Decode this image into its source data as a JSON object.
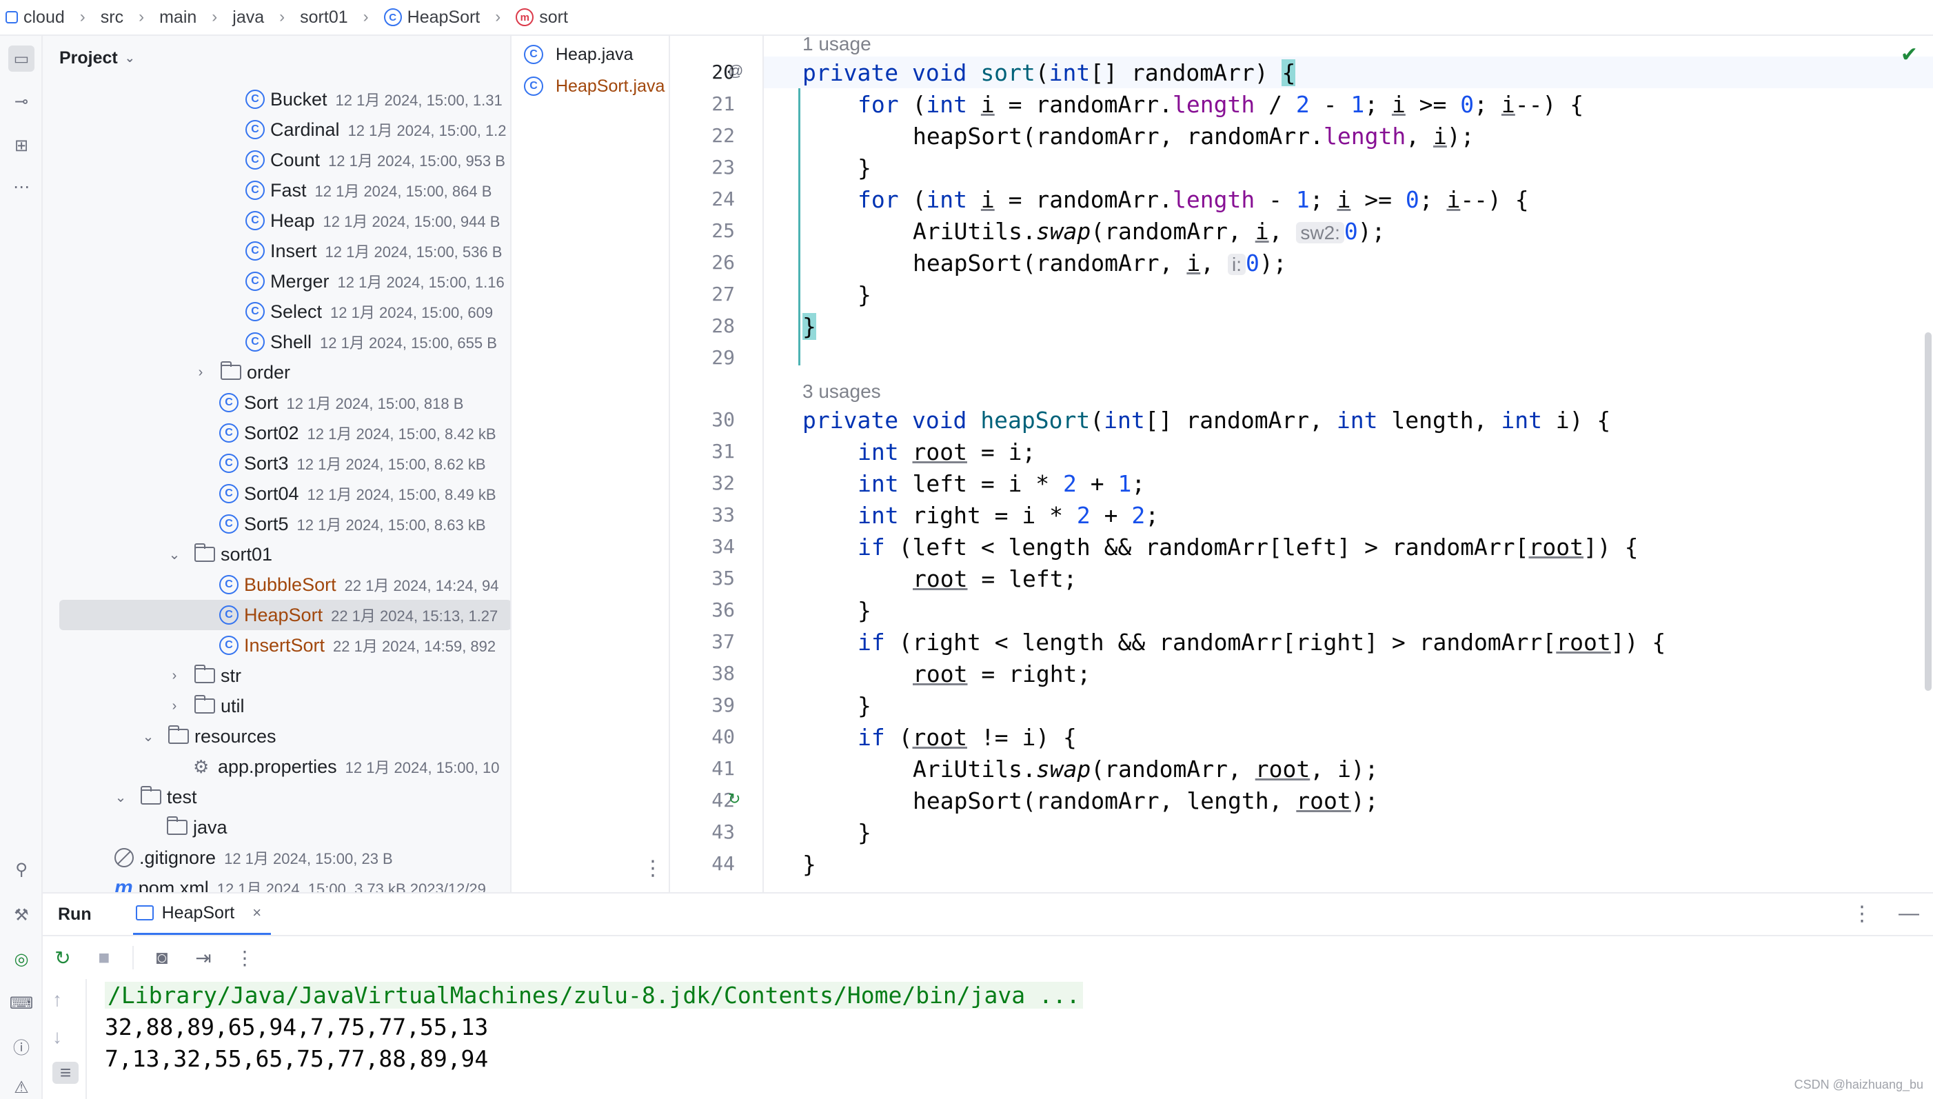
{
  "breadcrumb": [
    "cloud",
    "src",
    "main",
    "java",
    "sort01",
    "HeapSort",
    "sort"
  ],
  "project": {
    "title": "Project",
    "rows": [
      {
        "name": "Bucket",
        "meta": "12 1月 2024, 15:00, 1.31"
      },
      {
        "name": "Cardinal",
        "meta": "12 1月 2024, 15:00, 1.2"
      },
      {
        "name": "Count",
        "meta": "12 1月 2024, 15:00, 953 B"
      },
      {
        "name": "Fast",
        "meta": "12 1月 2024, 15:00, 864 B"
      },
      {
        "name": "Heap",
        "meta": "12 1月 2024, 15:00, 944 B"
      },
      {
        "name": "Insert",
        "meta": "12 1月 2024, 15:00, 536 B"
      },
      {
        "name": "Merger",
        "meta": "12 1月 2024, 15:00, 1.16"
      },
      {
        "name": "Select",
        "meta": "12 1月 2024, 15:00, 609"
      },
      {
        "name": "Shell",
        "meta": "12 1月 2024, 15:00, 655 B"
      },
      {
        "name": "order",
        "meta": ""
      },
      {
        "name": "Sort",
        "meta": "12 1月 2024, 15:00, 818 B"
      },
      {
        "name": "Sort02",
        "meta": "12 1月 2024, 15:00, 8.42 kB"
      },
      {
        "name": "Sort3",
        "meta": "12 1月 2024, 15:00, 8.62 kB"
      },
      {
        "name": "Sort04",
        "meta": "12 1月 2024, 15:00, 8.49 kB"
      },
      {
        "name": "Sort5",
        "meta": "12 1月 2024, 15:00, 8.63 kB"
      },
      {
        "name": "sort01",
        "meta": ""
      },
      {
        "name": "BubbleSort",
        "meta": "22 1月 2024, 14:24, 94"
      },
      {
        "name": "HeapSort",
        "meta": "22 1月 2024, 15:13, 1.27"
      },
      {
        "name": "InsertSort",
        "meta": "22 1月 2024, 14:59, 892"
      },
      {
        "name": "str",
        "meta": ""
      },
      {
        "name": "util",
        "meta": ""
      },
      {
        "name": "resources",
        "meta": ""
      },
      {
        "name": "app.properties",
        "meta": "12 1月 2024, 15:00, 10"
      },
      {
        "name": "test",
        "meta": ""
      },
      {
        "name": "java",
        "meta": ""
      },
      {
        "name": ".gitignore",
        "meta": "12 1月 2024, 15:00, 23 B"
      },
      {
        "name": "pom.xml",
        "meta": "12 1月 2024, 15:00, 3.73 kB 2023/12/29"
      }
    ]
  },
  "tabs": [
    {
      "label": "Heap.java"
    },
    {
      "label": "HeapSort.java"
    }
  ],
  "editor": {
    "usage1": "1 usage",
    "usage2": "3 usages",
    "line_numbers": [
      "20",
      "21",
      "22",
      "23",
      "24",
      "25",
      "26",
      "27",
      "28",
      "29",
      "30",
      "31",
      "32",
      "33",
      "34",
      "35",
      "36",
      "37",
      "38",
      "39",
      "40",
      "41",
      "42",
      "43",
      "44"
    ],
    "l20": {
      "kw1": "private",
      "kw2": "void",
      "name": "sort",
      "pre": "(",
      "kw3": "int",
      "rest": "[] randomArr) ",
      "brace": "{"
    },
    "l21": {
      "kw": "for",
      "a": " (",
      "kw2": "int",
      "b": " ",
      "i1": "i",
      "c": " = randomArr.",
      "f": "length",
      "d": " / ",
      "n1": "2",
      "e": " - ",
      "n2": "1",
      "g": "; ",
      "i2": "i",
      "h": " >= ",
      "n3": "0",
      "j": "; ",
      "i3": "i",
      "k": "--) {"
    },
    "l22": {
      "a": "heapSort(randomArr, randomArr.",
      "f": "length",
      "b": ", ",
      "i": "i",
      "c": ");"
    },
    "l23": "}",
    "l24": {
      "kw": "for",
      "a": " (",
      "kw2": "int",
      "b": " ",
      "i1": "i",
      "c": " = randomArr.",
      "f": "length",
      "d": " - ",
      "n1": "1",
      "g": "; ",
      "i2": "i",
      "h": " >= ",
      "n3": "0",
      "j": "; ",
      "i3": "i",
      "k": "--) {"
    },
    "l25": {
      "a": "AriUtils.",
      "s": "swap",
      "b": "(randomArr, ",
      "i": "i",
      "c": ", ",
      "hint": "sw2:",
      "n": "0",
      "d": ");"
    },
    "l26": {
      "a": "heapSort(randomArr, ",
      "i": "i",
      "c": ", ",
      "hint": "i:",
      "n": "0",
      "d": ");"
    },
    "l27": "}",
    "l28": "}",
    "l30": {
      "kw1": "private",
      "kw2": "void",
      "name": "heapSort",
      "a": "(",
      "kw3": "int",
      "b": "[] randomArr, ",
      "kw4": "int",
      "c": " length, ",
      "kw5": "int",
      "d": " i) {"
    },
    "l31": {
      "kw": "int",
      "v": "root",
      "rest": " = i;"
    },
    "l32": {
      "kw": "int",
      "a": " left = i * ",
      "n1": "2",
      "b": " + ",
      "n2": "1",
      "c": ";"
    },
    "l33": {
      "kw": "int",
      "a": " right = i * ",
      "n1": "2",
      "b": " + ",
      "n2": "2",
      "c": ";"
    },
    "l34": {
      "kw": "if",
      "a": " (left < length && randomArr[left] > randomArr[",
      "v": "root",
      "b": "]) {"
    },
    "l35": {
      "v": "root",
      "rest": " = left;"
    },
    "l36": "}",
    "l37": {
      "kw": "if",
      "a": " (right < length && randomArr[right] > randomArr[",
      "v": "root",
      "b": "]) {"
    },
    "l38": {
      "v": "root",
      "rest": " = right;"
    },
    "l39": "}",
    "l40": {
      "kw": "if",
      "a": " (",
      "v": "root",
      "b": " != i) {"
    },
    "l41": {
      "a": "AriUtils.",
      "s": "swap",
      "b": "(randomArr, ",
      "v": "root",
      "c": ", i);"
    },
    "l42": {
      "a": "heapSort(randomArr, length, ",
      "v": "root",
      "b": ");"
    },
    "l43": "}",
    "l44": "}"
  },
  "run": {
    "title": "Run",
    "tab": "HeapSort",
    "close": "×",
    "lines": [
      "/Library/Java/JavaVirtualMachines/zulu-8.jdk/Contents/Home/bin/java ...",
      "32,88,89,65,94,7,75,77,55,13",
      "7,13,32,55,65,75,77,88,89,94"
    ]
  },
  "watermark": "CSDN @haizhuang_bu",
  "colors": {
    "keyword": "#0033b3",
    "method": "#00627a",
    "field": "#871094",
    "number": "#1750eb",
    "modified": "#a1470c",
    "accent": "#3574f0"
  }
}
